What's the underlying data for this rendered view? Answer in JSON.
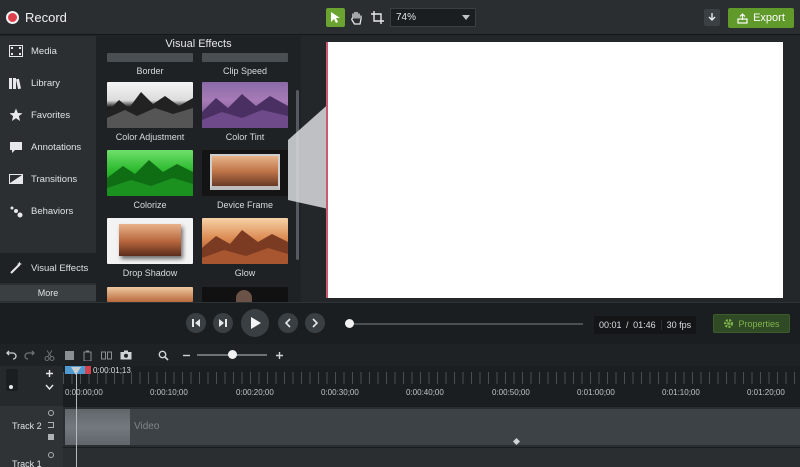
{
  "header": {
    "record_label": "Record",
    "zoom_value": "74%",
    "export_label": "Export"
  },
  "nav": {
    "items": [
      {
        "label": "Media",
        "icon": "film-icon"
      },
      {
        "label": "Library",
        "icon": "library-icon"
      },
      {
        "label": "Favorites",
        "icon": "star-icon"
      },
      {
        "label": "Annotations",
        "icon": "annotation-icon"
      },
      {
        "label": "Transitions",
        "icon": "transition-icon"
      },
      {
        "label": "Behaviors",
        "icon": "behaviors-icon"
      },
      {
        "label": "Visual Effects",
        "icon": "wand-icon"
      }
    ],
    "active": "Visual Effects",
    "more_label": "More"
  },
  "effects": {
    "title": "Visual Effects",
    "tiles": [
      {
        "label": "Border"
      },
      {
        "label": "Clip Speed"
      },
      {
        "label": "Color Adjustment"
      },
      {
        "label": "Color Tint"
      },
      {
        "label": "Colorize"
      },
      {
        "label": "Device Frame"
      },
      {
        "label": "Drop Shadow"
      },
      {
        "label": "Glow"
      }
    ]
  },
  "playback": {
    "time_current": "00:01",
    "time_separator": "/",
    "time_total": "01:46",
    "fps": "30 fps",
    "properties_label": "Properties"
  },
  "timeline": {
    "playhead_time": "0:00:01;13",
    "ruler": [
      "0:00:00;00",
      "0:00:10;00",
      "0:00:20;00",
      "0:00:30;00",
      "0:00:40;00",
      "0:00:50;00",
      "0:01:00;00",
      "0:01:10;00",
      "0:01:20;00"
    ],
    "tracks": [
      {
        "label": "Track 2"
      },
      {
        "label": "Track 1"
      }
    ],
    "clip_label": "Video"
  },
  "colors": {
    "accent_green": "#6aa32f",
    "record_red": "#e0404e",
    "playhead_blue": "#4e9ad1"
  }
}
